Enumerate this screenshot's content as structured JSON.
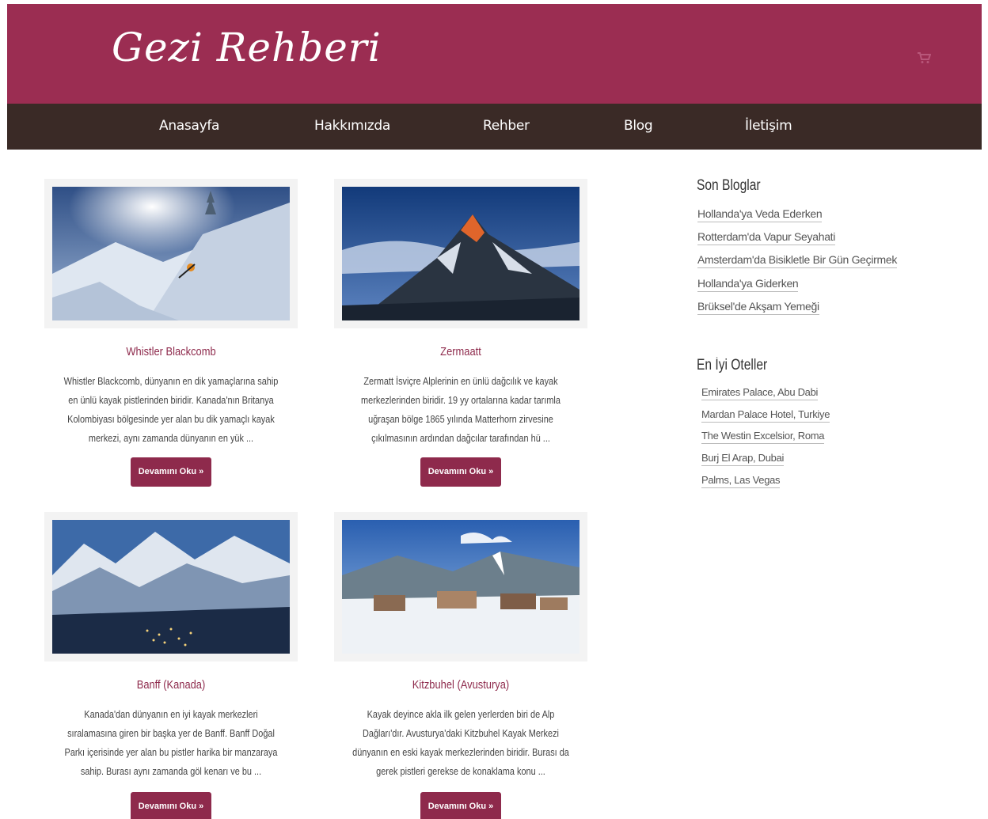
{
  "header": {
    "site_title": "Gezi Rehberi"
  },
  "nav": {
    "items": [
      "Anasayfa",
      "Hakkımızda",
      "Rehber",
      "Blog",
      "İletişim"
    ]
  },
  "cards": [
    {
      "title": "Whistler Blackcomb",
      "text": "Whistler Blackcomb, dünyanın en dik yamaçlarına sahip en ünlü kayak pistlerinden biridir. Kanada'nın Britanya Kolombiyası bölgesinde yer alan bu dik yamaçlı kayak merkezi, aynı zamanda dünyanın en yük ...",
      "button": "Devamını Oku »"
    },
    {
      "title": "Zermaatt",
      "text": "Zermatt İsviçre Alplerinin en ünlü dağcılık ve kayak merkezlerinden biridir. 19 yy ortalarına kadar tarımla uğraşan bölge 1865 yılında Matterhorn zirvesine çıkılmasının ardından dağcılar tarafından hü ...",
      "button": "Devamını Oku »"
    },
    {
      "title": "Banff (Kanada)",
      "text": "Kanada'dan dünyanın en iyi kayak merkezleri sıralamasına giren bir başka yer de Banff. Banff Doğal Parkı içerisinde yer alan bu pistler harika bir manzaraya sahip. Burası aynı zamanda göl kenarı ve bu ...",
      "button": "Devamını Oku »"
    },
    {
      "title": "Kitzbuhel (Avusturya)",
      "text": "Kayak deyince akla ilk gelen yerlerden biri de Alp Dağları'dır. Avusturya'daki Kitzbuhel Kayak Merkezi dünyanın en eski kayak merkezlerinden biridir. Burası da gerek pistleri gerekse de konaklama konu ...",
      "button": "Devamını Oku »"
    }
  ],
  "sidebar": {
    "blogs_heading": "Son Bloglar",
    "blogs": [
      "Hollanda'ya Veda Ederken",
      "Rotterdam'da Vapur Seyahati",
      "Amsterdam'da Bisikletle Bir Gün Geçirmek",
      "Hollanda'ya Giderken",
      "Brüksel'de Akşam Yemeği"
    ],
    "hotels_heading": "En İyi Oteller",
    "hotels": [
      "Emirates Palace, Abu Dabi",
      "Mardan Palace Hotel, Turkiye",
      "The Westin Excelsior, Roma",
      "Burj El Arap, Dubai",
      "Palms, Las Vegas"
    ]
  },
  "colors": {
    "brand": "#9b2d52",
    "nav": "#3a2a26",
    "button": "#8e2a4c"
  }
}
